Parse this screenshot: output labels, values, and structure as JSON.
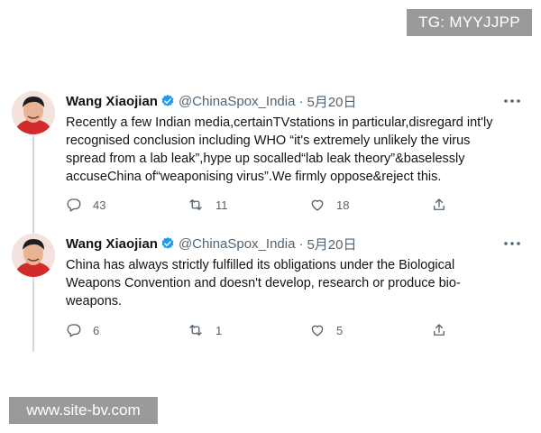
{
  "watermarks": {
    "top": "TG: MYYJJPP",
    "bottom": "www.site-bv.com"
  },
  "tweets": [
    {
      "name": "Wang Xiaojian",
      "handle": "@ChinaSpox_India",
      "separator": "·",
      "date": "5月20日",
      "text": "Recently a few Indian media,certainTVstations in particular,disregard int'ly recognised conclusion including WHO “it's extremely unlikely the virus spread from a lab leak”,hype up socalled“lab leak theory”&baselessly accuseChina of“weaponising virus”.We firmly oppose&reject this.",
      "replies": "43",
      "retweets": "11",
      "likes": "18"
    },
    {
      "name": "Wang Xiaojian",
      "handle": "@ChinaSpox_India",
      "separator": "·",
      "date": "5月20日",
      "text": "China has always strictly fulfilled its obligations under the Biological Weapons Convention and doesn't develop, research or produce bio-weapons.",
      "replies": "6",
      "retweets": "1",
      "likes": "5"
    }
  ],
  "colors": {
    "verified": "#1d9bf0",
    "secondary_text": "#536471",
    "thread_line": "#cfd9de"
  },
  "icons": [
    "verified-badge-icon",
    "more-icon",
    "reply-icon",
    "retweet-icon",
    "like-icon",
    "share-icon"
  ]
}
